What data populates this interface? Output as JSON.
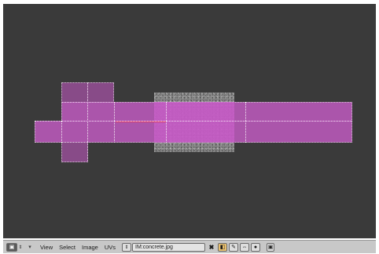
{
  "header": {
    "editor_type_icon": "image-editor-icon",
    "updown_glyph": "⇕",
    "collapse_glyph": "▾",
    "menus": [
      "View",
      "Select",
      "Image",
      "UVs"
    ],
    "image_browse_glyph": "⇕",
    "image_name": "IM:concrete.jpg",
    "close_glyph": "✖",
    "tool_icons": [
      "texture-paint-icon",
      "pin-icon",
      "sync-icon",
      "dot-icon"
    ],
    "tool_glyphs": [
      "◧",
      "✎",
      "⇔",
      "●"
    ],
    "lock_glyph": "🔒",
    "lock_icon": "lock-icon"
  },
  "colors": {
    "viewport_bg": "#3a3a3a",
    "uv_face": "#c45bc4",
    "uv_face_dark": "#9a4f9a",
    "header_bg": "#c8c8c8",
    "active_tool": "#e8c070"
  }
}
